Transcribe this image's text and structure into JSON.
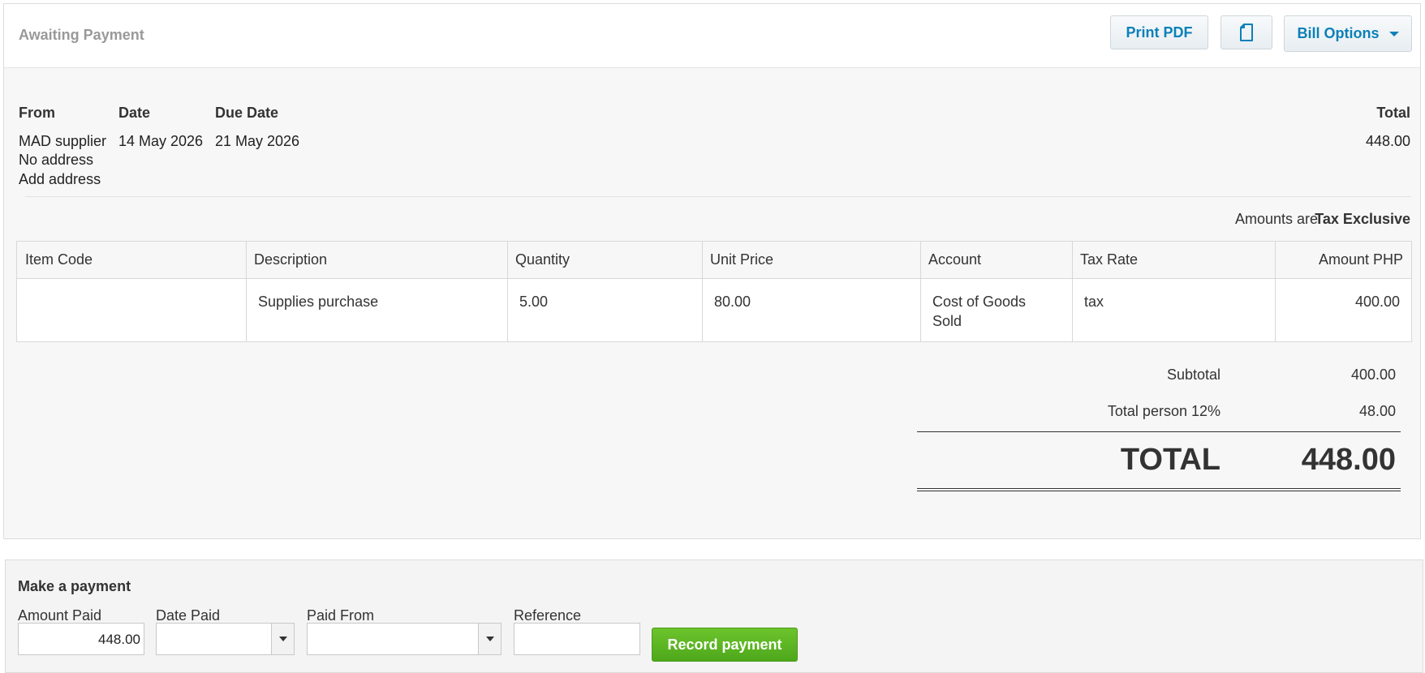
{
  "header": {
    "status": "Awaiting Payment",
    "print_label": "Print PDF",
    "copy_icon": "document-copy-icon",
    "options_label": "Bill Options"
  },
  "bill": {
    "from_label": "From",
    "date_label": "Date",
    "due_label": "Due Date",
    "total_label": "Total",
    "supplier": "MAD supplier",
    "address": "No address",
    "add_address": "Add address",
    "date": "14 May 2026",
    "due_date": "21 May 2026",
    "total": "448.00",
    "amounts_are_label": "Amounts are",
    "amounts_are_value": "Tax Exclusive"
  },
  "items": {
    "headers": [
      "Item Code",
      "Description",
      "Quantity",
      "Unit Price",
      "Account",
      "Tax Rate",
      "Amount PHP"
    ],
    "rows": [
      {
        "item_code": "",
        "description": "Supplies purchase",
        "quantity": "5.00",
        "unit_price": "80.00",
        "account": "Cost of Goods Sold",
        "tax_rate": "tax",
        "amount": "400.00"
      }
    ]
  },
  "totals": {
    "subtotal_label": "Subtotal",
    "subtotal": "400.00",
    "tax_label": "Total person 12%",
    "tax": "48.00",
    "total_label": "TOTAL",
    "total": "448.00"
  },
  "payment": {
    "title": "Make a payment",
    "amount_label": "Amount Paid",
    "amount_value": "448.00",
    "date_label": "Date Paid",
    "date_value": "",
    "from_label": "Paid From",
    "from_value": "",
    "reference_label": "Reference",
    "reference_value": "",
    "record_label": "Record payment"
  },
  "colors": {
    "link": "#0b8dc5",
    "record_button": "#5cb722",
    "panel_bg": "#f7f7f7"
  }
}
